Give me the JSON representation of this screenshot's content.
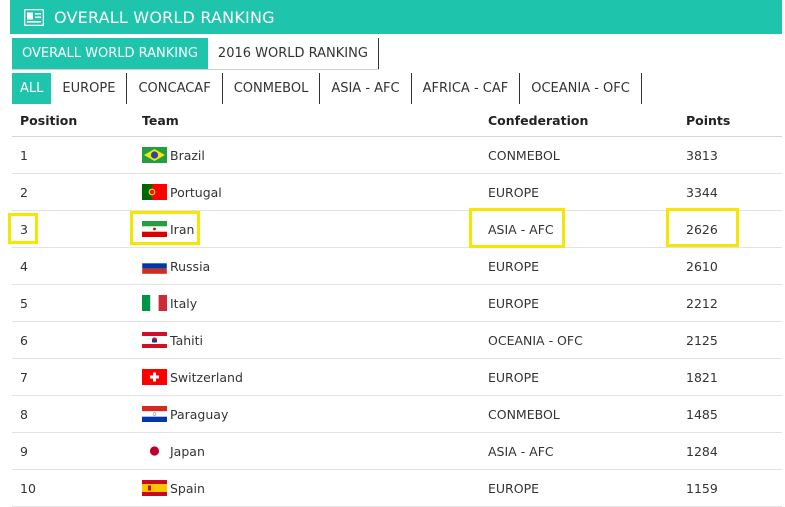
{
  "header": {
    "title": "OVERALL WORLD RANKING",
    "icon": "id-card-icon"
  },
  "ranking_tabs": [
    {
      "label": "OVERALL WORLD RANKING",
      "active": true
    },
    {
      "label": "2016 WORLD RANKING",
      "active": false
    }
  ],
  "region_tabs": [
    {
      "label": "ALL",
      "active": true
    },
    {
      "label": "EUROPE",
      "active": false
    },
    {
      "label": "CONCACAF",
      "active": false
    },
    {
      "label": "CONMEBOL",
      "active": false
    },
    {
      "label": "ASIA - AFC",
      "active": false
    },
    {
      "label": "AFRICA - CAF",
      "active": false
    },
    {
      "label": "OCEANIA - OFC",
      "active": false
    }
  ],
  "table": {
    "headers": {
      "position": "Position",
      "team": "Team",
      "confederation": "Confederation",
      "points": "Points"
    },
    "rows": [
      {
        "position": "1",
        "team": "Brazil",
        "confederation": "CONMEBOL",
        "points": "3813",
        "flag": "brazil-flag"
      },
      {
        "position": "2",
        "team": "Portugal",
        "confederation": "EUROPE",
        "points": "3344",
        "flag": "portugal-flag"
      },
      {
        "position": "3",
        "team": "Iran",
        "confederation": "ASIA - AFC",
        "points": "2626",
        "flag": "iran-flag"
      },
      {
        "position": "4",
        "team": "Russia",
        "confederation": "EUROPE",
        "points": "2610",
        "flag": "russia-flag"
      },
      {
        "position": "5",
        "team": "Italy",
        "confederation": "EUROPE",
        "points": "2212",
        "flag": "italy-flag"
      },
      {
        "position": "6",
        "team": "Tahiti",
        "confederation": "OCEANIA - OFC",
        "points": "2125",
        "flag": "tahiti-flag"
      },
      {
        "position": "7",
        "team": "Switzerland",
        "confederation": "EUROPE",
        "points": "1821",
        "flag": "switzerland-flag"
      },
      {
        "position": "8",
        "team": "Paraguay",
        "confederation": "CONMEBOL",
        "points": "1485",
        "flag": "paraguay-flag"
      },
      {
        "position": "9",
        "team": "Japan",
        "confederation": "ASIA - AFC",
        "points": "1284",
        "flag": "japan-flag"
      },
      {
        "position": "10",
        "team": "Spain",
        "confederation": "EUROPE",
        "points": "1159",
        "flag": "spain-flag"
      }
    ]
  },
  "colors": {
    "accent": "#1fc4ad",
    "highlight": "#f7e600"
  }
}
